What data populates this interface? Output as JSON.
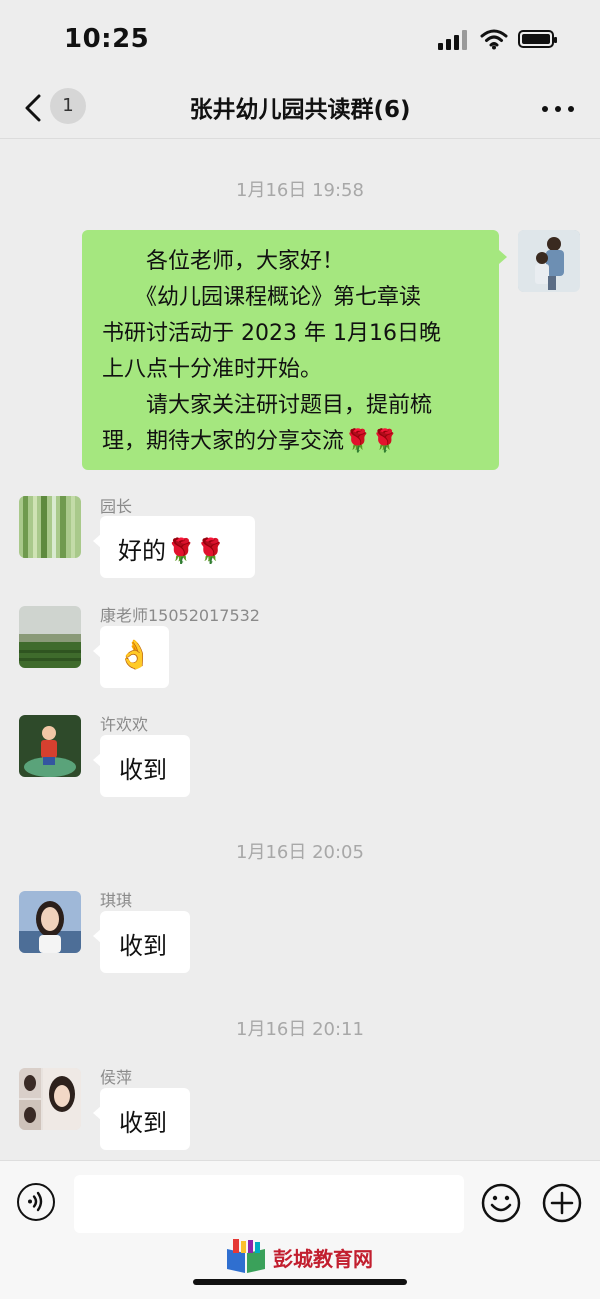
{
  "status_bar": {
    "time": "10:25"
  },
  "nav": {
    "unread_count": "1",
    "title": "张井幼儿园共读群(6)"
  },
  "messages": [
    {
      "kind": "time",
      "text": "1月16日 19:58"
    },
    {
      "kind": "mine",
      "lines": [
        "　　各位老师，大家好！",
        "　　《幼儿园课程概论》第七章读",
        "书研讨活动于 2023 年 1月16日晚",
        "上八点十分准时开始。",
        "　　请大家关注研讨题目，提前梳",
        "理，期待大家的分享交流"
      ],
      "emoji": "🌹🌹"
    },
    {
      "kind": "other",
      "sender": "园长",
      "text": "好的",
      "emoji": "🌹🌹"
    },
    {
      "kind": "other",
      "sender": "康老师15052017532",
      "emoji": "👌"
    },
    {
      "kind": "other",
      "sender": "许欢欢",
      "text": "收到"
    },
    {
      "kind": "time",
      "text": "1月16日 20:05"
    },
    {
      "kind": "other",
      "sender": "琪琪",
      "text": "收到"
    },
    {
      "kind": "time",
      "text": "1月16日 20:11"
    },
    {
      "kind": "other",
      "sender": "侯萍",
      "text": "收到"
    }
  ],
  "input": {
    "placeholder": ""
  },
  "watermark": {
    "text": "彭城教育网"
  },
  "colors": {
    "bubble_mine": "#a5e77f",
    "bubble_other": "#ffffff",
    "background": "#ededed"
  },
  "icons": [
    "back-chevron-icon",
    "more-icon",
    "voice-icon",
    "emoji-icon",
    "plus-icon",
    "book-logo-icon"
  ]
}
